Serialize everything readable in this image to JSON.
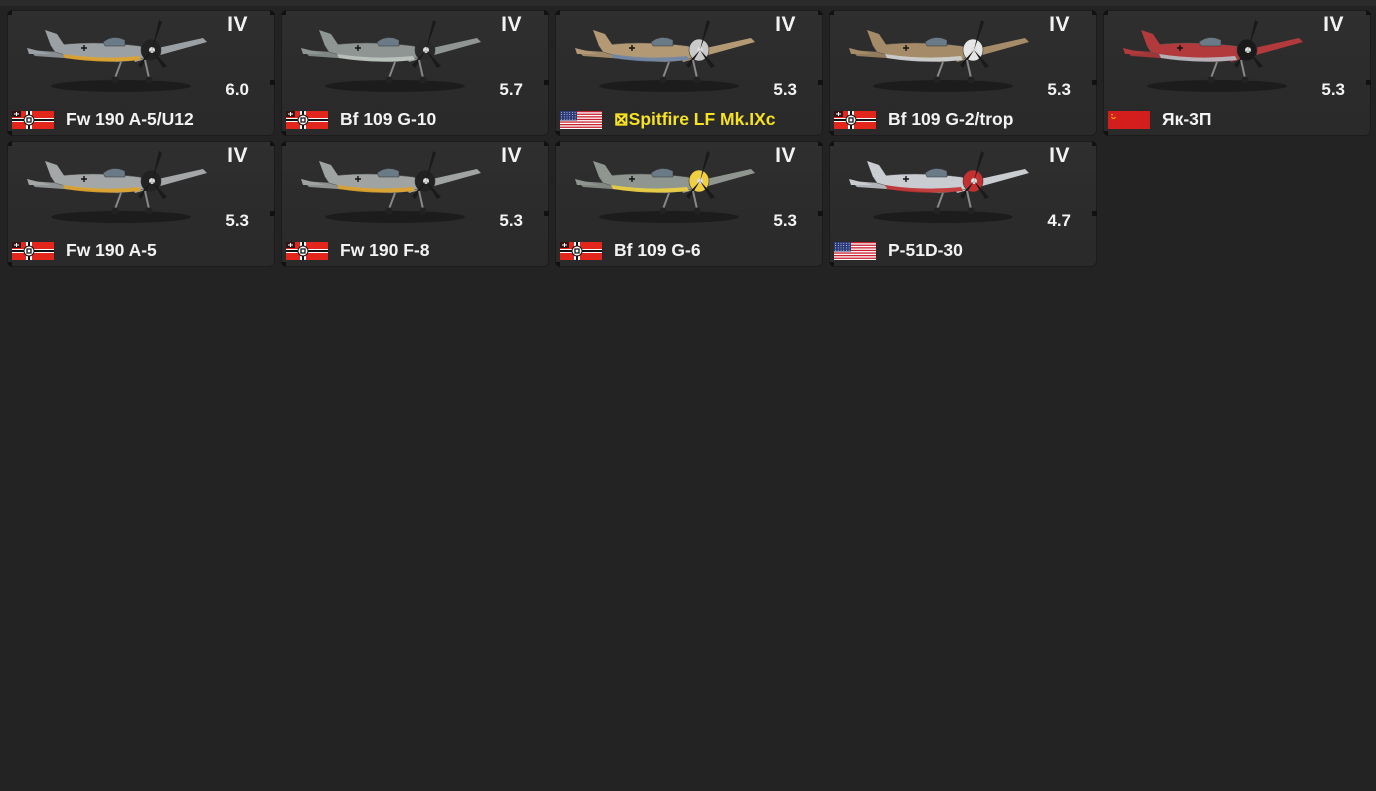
{
  "cards": [
    {
      "rank": "IV",
      "br": "6.0",
      "name": "Fw 190 A-5/U12",
      "nation": "germany",
      "premium": false,
      "camo": "#9aa0a4",
      "accent": "#e0a32a",
      "spinner": "#222"
    },
    {
      "rank": "IV",
      "br": "5.7",
      "name": "Bf 109 G-10",
      "nation": "germany",
      "premium": false,
      "camo": "#8e9592",
      "accent": "#bfc5c0",
      "spinner": "#2a2a2a"
    },
    {
      "rank": "IV",
      "br": "5.3",
      "name": "⊠Spitfire LF Mk.IXc",
      "nation": "usa",
      "premium": true,
      "camo": "#b49a74",
      "accent": "#6f86a6",
      "spinner": "#c9c9c9"
    },
    {
      "rank": "IV",
      "br": "5.3",
      "name": "Bf 109 G-2/trop",
      "nation": "germany",
      "premium": false,
      "camo": "#a58b67",
      "accent": "#cfd3d5",
      "spinner": "#e6e6e6"
    },
    {
      "rank": "IV",
      "br": "5.3",
      "name": "Як-3П",
      "nation": "ussr",
      "premium": false,
      "camo": "#b33a3c",
      "accent": "#b8bcc4",
      "spinner": "#1a1a1a"
    },
    {
      "rank": "IV",
      "br": "5.3",
      "name": "Fw 190 A-5",
      "nation": "germany",
      "premium": false,
      "camo": "#a3a7a8",
      "accent": "#e0a32a",
      "spinner": "#222"
    },
    {
      "rank": "IV",
      "br": "5.3",
      "name": "Fw 190 F-8",
      "nation": "germany",
      "premium": false,
      "camo": "#9fa3a2",
      "accent": "#e0a32a",
      "spinner": "#222"
    },
    {
      "rank": "IV",
      "br": "5.3",
      "name": "Bf 109 G-6",
      "nation": "germany",
      "premium": false,
      "camo": "#8f9690",
      "accent": "#f0d040",
      "spinner": "#f0d040"
    },
    {
      "rank": "IV",
      "br": "4.7",
      "name": "P-51D-30",
      "nation": "usa",
      "premium": false,
      "camo": "#c9cdd1",
      "accent": "#c23030",
      "spinner": "#c23030"
    }
  ],
  "colors": {
    "background": "#232323",
    "card": "#2d2d2d",
    "text": "#f2f2f2",
    "premium_text": "#f6e221"
  }
}
